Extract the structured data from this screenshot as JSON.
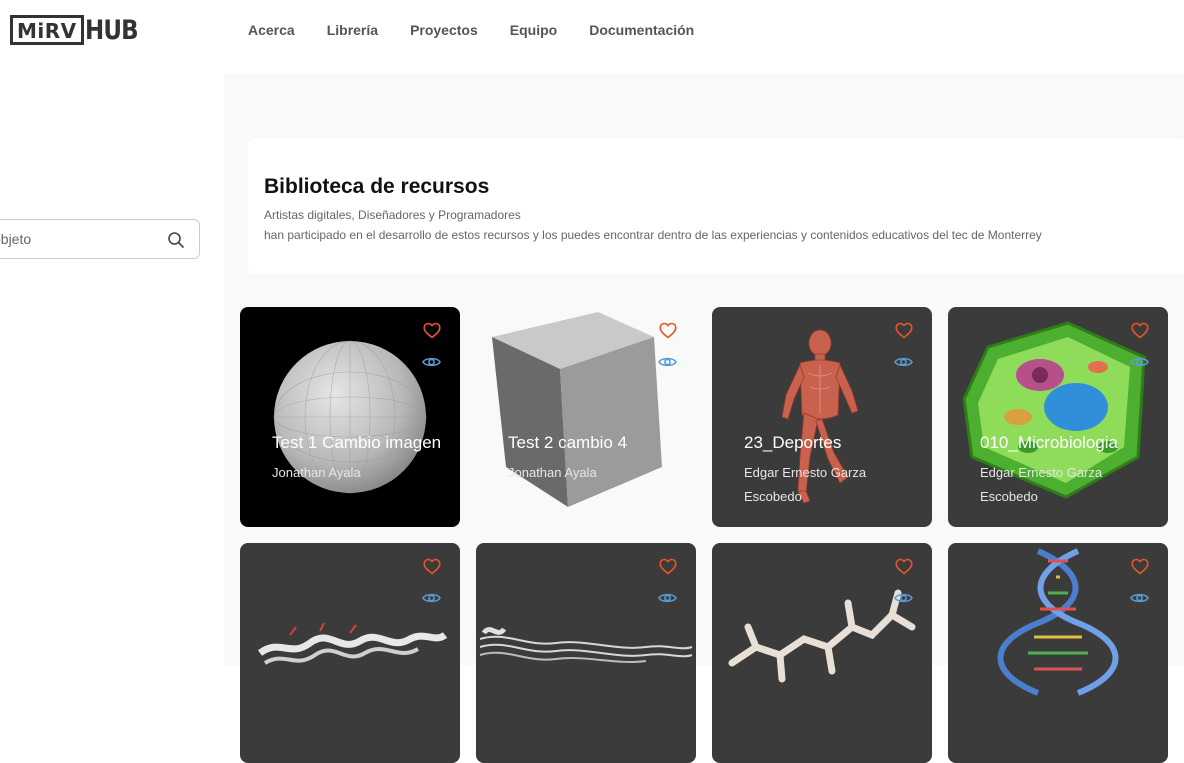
{
  "brand": {
    "logo_box": "MiRV",
    "logo_text": "HUB"
  },
  "nav": [
    "Acerca",
    "Librería",
    "Proyectos",
    "Equipo",
    "Documentación"
  ],
  "search": {
    "placeholder": "objeto"
  },
  "banner": {
    "title": "Biblioteca de recursos",
    "subtitle": "Artistas digitales, Diseñadores y Programadores",
    "description": "han participado en el desarrollo de estos recursos y los puedes encontrar dentro de las experiencias y contenidos educativos del tec de Monterrey"
  },
  "colors": {
    "heart": "#e8542a",
    "eye": "#5b9bd5",
    "card_dark": "#3b3b3b"
  },
  "cards": [
    {
      "title": "Test 1 Cambio imagen",
      "author": "Jonathan Ayala",
      "image": "sphere"
    },
    {
      "title": "Test 2 cambio 4",
      "author": "Jonathan Ayala",
      "image": "cube"
    },
    {
      "title": "23_Deportes",
      "author": "Edgar Ernesto Garza Escobedo",
      "image": "human-anatomy"
    },
    {
      "title": "010_Microbiologia",
      "author": "Edgar Ernesto Garza Escobedo",
      "image": "plant-cell"
    },
    {
      "title": "",
      "author": "",
      "image": "protein"
    },
    {
      "title": "",
      "author": "",
      "image": "protein-strands"
    },
    {
      "title": "",
      "author": "",
      "image": "molecule"
    },
    {
      "title": "",
      "author": "",
      "image": "dna-helix"
    }
  ]
}
